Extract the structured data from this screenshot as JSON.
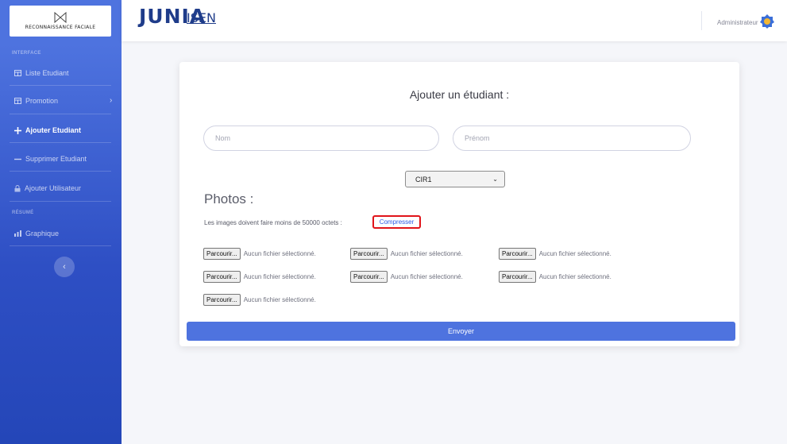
{
  "brand": {
    "text": "RECONNAISSANCE FACIALE",
    "logo_icon": "butterfly-icon"
  },
  "sidebar": {
    "heading_interface": "INTERFACE",
    "heading_resume": "RÉSUMÉ",
    "items": [
      {
        "label": "Liste Etudiant",
        "icon": "table-icon"
      },
      {
        "label": "Promotion",
        "icon": "table-icon"
      },
      {
        "label": "Ajouter Etudiant",
        "icon": "plus-icon",
        "active": true
      },
      {
        "label": "Supprimer Etudiant",
        "icon": "minus-icon"
      },
      {
        "label": "Ajouter Utilisateur",
        "icon": "lock-icon"
      },
      {
        "label": "Graphique",
        "icon": "chart-icon"
      }
    ],
    "toggle_icon": "chevron-left-icon",
    "promotion_chevron": "›"
  },
  "topbar": {
    "logo_main": "JUNIA",
    "logo_sub": "ISEN",
    "user_name": "Administrateur",
    "avatar_icon": "user-avatar-icon"
  },
  "form": {
    "title": "Ajouter un étudiant :",
    "nom_placeholder": "Nom",
    "prenom_placeholder": "Prénom",
    "promotion_value": "CIR1",
    "photos_title": "Photos :",
    "hint": "Les images doivent faire moins de 50000 octets :",
    "compress_link": "Compresser",
    "file_button_label": "Parcourir...",
    "file_status": "Aucun fichier sélectionné.",
    "file_inputs_count": 7,
    "submit_label": "Envoyer"
  },
  "colors": {
    "sidebar": "#4e73df",
    "primary": "#4e73df",
    "highlight": "#e0141a",
    "logo": "#1f3c8a"
  }
}
